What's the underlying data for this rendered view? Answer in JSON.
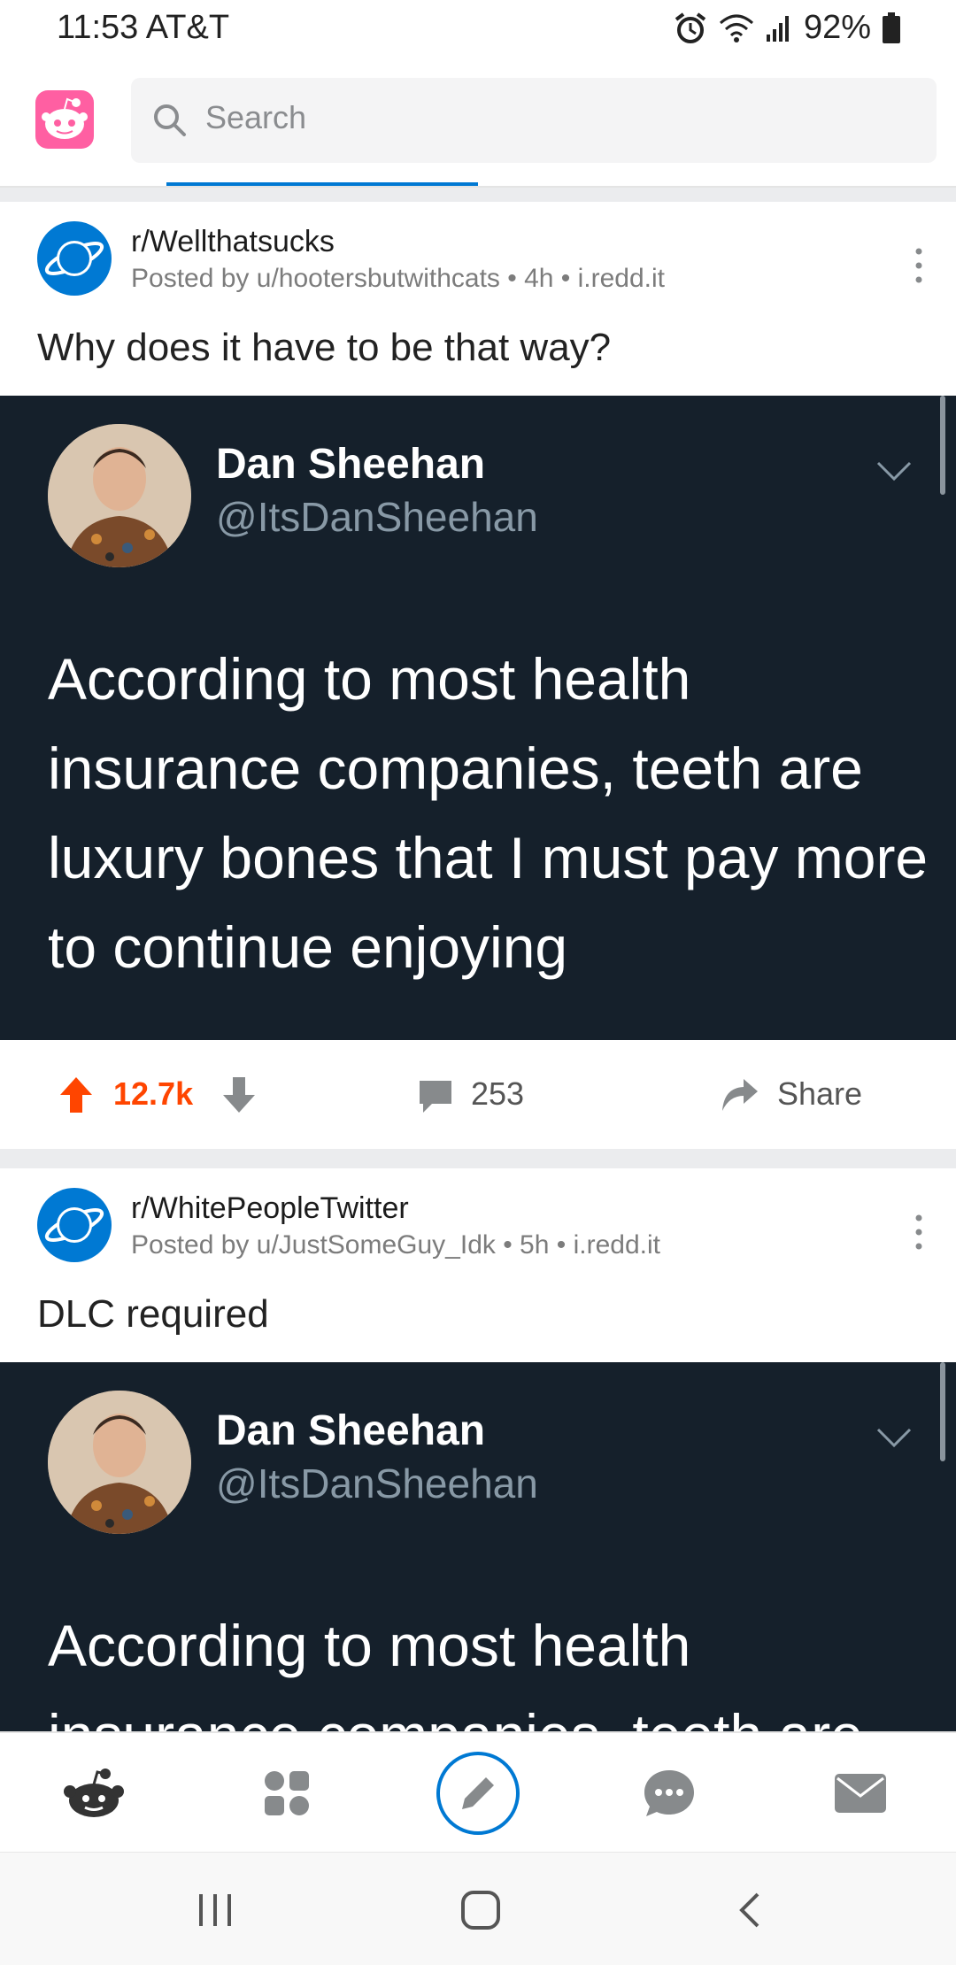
{
  "status_bar": {
    "time_carrier": "11:53 AT&T",
    "battery": "92%"
  },
  "search": {
    "placeholder": "Search"
  },
  "posts": [
    {
      "subreddit": "r/Wellthatsucks",
      "meta": "Posted by u/hootersbutwithcats • 4h • i.redd.it",
      "title": "Why does it have to be that way?",
      "tweet": {
        "name": "Dan Sheehan",
        "handle": "@ItsDanSheehan",
        "text": "According to most health insurance companies, teeth are luxury bones that I must pay more to continue enjoying"
      },
      "votes": "12.7k",
      "comments": "253",
      "share": "Share"
    },
    {
      "subreddit": "r/WhitePeopleTwitter",
      "meta": "Posted by u/JustSomeGuy_Idk • 5h • i.redd.it",
      "title": "DLC required",
      "tweet": {
        "name": "Dan Sheehan",
        "handle": "@ItsDanSheehan",
        "text": "According to most health insurance companies, teeth are"
      }
    }
  ],
  "colors": {
    "accent_blue": "#0079d3",
    "upvote_orange": "#ff4500",
    "tweet_bg": "#15202b",
    "app_logo_pink": "#ff5fa2"
  },
  "icons": {
    "nav": [
      "reddit-home-icon",
      "communities-icon",
      "create-post-icon",
      "chat-icon",
      "inbox-icon"
    ],
    "system": [
      "recent-apps-icon",
      "home-icon",
      "back-icon"
    ]
  }
}
